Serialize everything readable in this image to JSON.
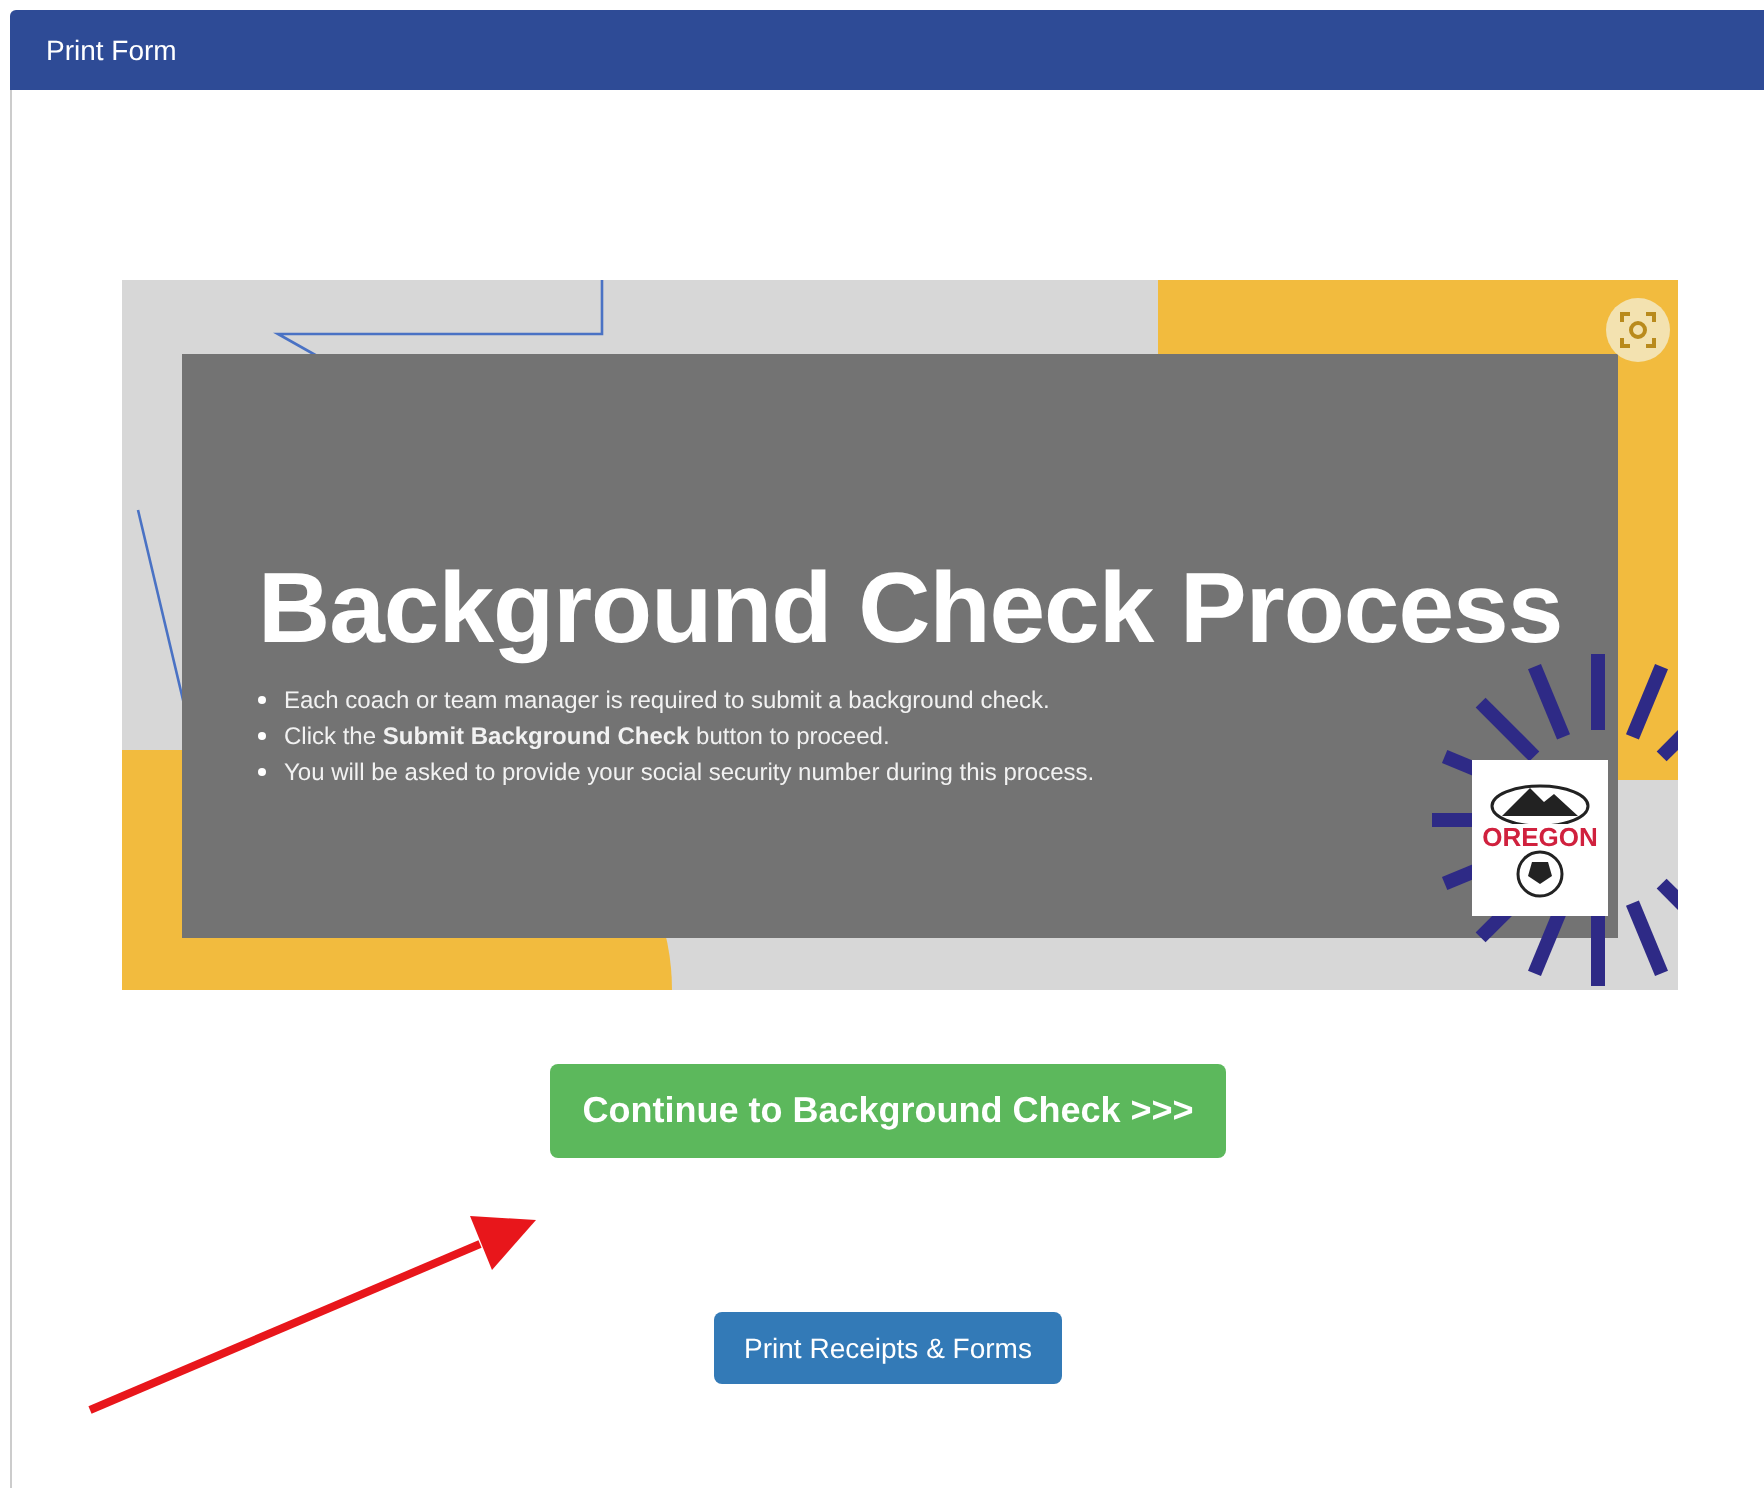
{
  "window": {
    "title": "Print Form"
  },
  "banner": {
    "title": "Background Check Process",
    "bullets": [
      "Each coach or team manager is required to submit a background check.",
      "Click the **Submit Background Check** button to proceed.",
      "You will be asked to provide your social security number during this process."
    ],
    "logo_text": "OREGON"
  },
  "buttons": [
    {
      "label": "Continue to Background Check >>>",
      "kind": "primary"
    },
    {
      "label": "Print Receipts & Forms",
      "kind": "secondary"
    }
  ]
}
